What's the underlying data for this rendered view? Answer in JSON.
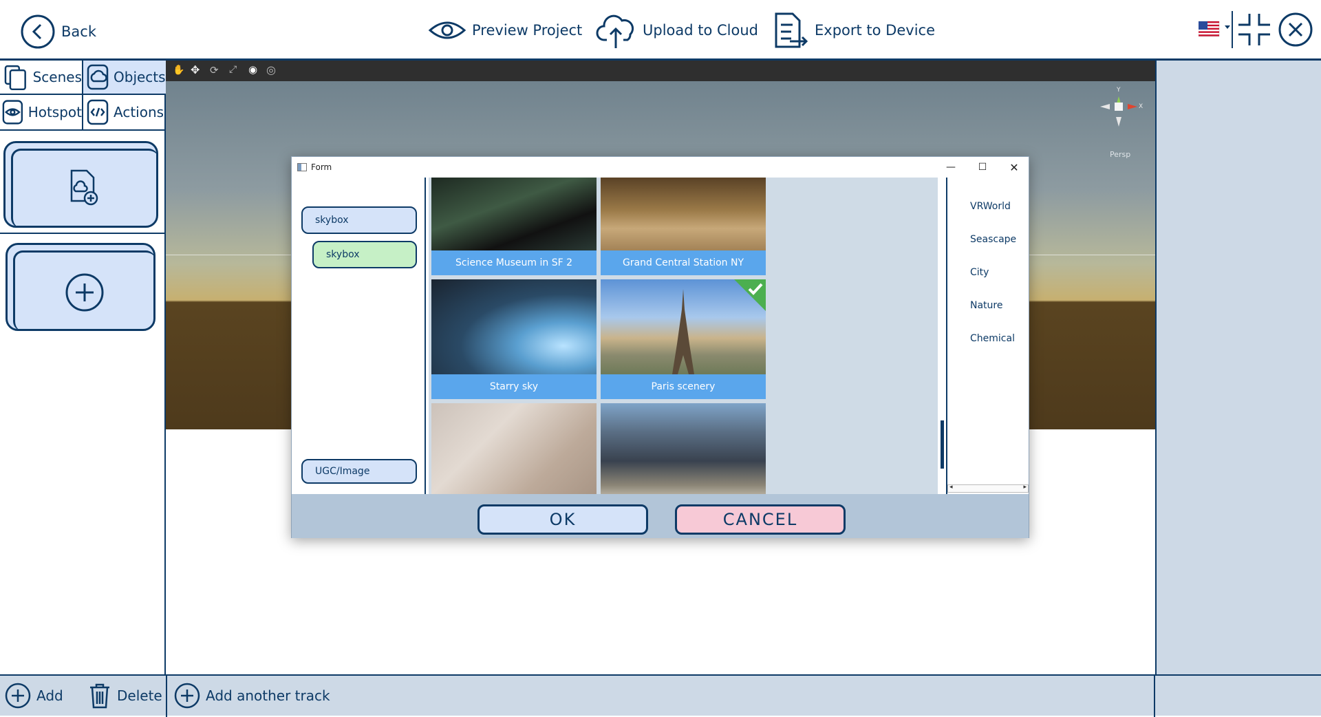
{
  "topbar": {
    "back_label": "Back",
    "preview_label": "Preview Project",
    "upload_label": "Upload to Cloud",
    "export_label": "Export to Device"
  },
  "left": {
    "tabs": {
      "scenes": "Scenes",
      "objects": "Objects",
      "hotspot": "Hotspot",
      "actions": "Actions"
    }
  },
  "bottombar": {
    "add_label": "Add",
    "delete_label": "Delete",
    "add_track_label": "Add another track"
  },
  "viewport": {
    "gizmo_y": "Y",
    "gizmo_x": "X",
    "gizmo_label": "Persp"
  },
  "dialog": {
    "title": "Form",
    "tree": {
      "root": "skybox",
      "child": "skybox",
      "ugc": "UGC/Image"
    },
    "tiles": [
      {
        "caption": "Science Museum in SF 2",
        "selected": false
      },
      {
        "caption": "Grand Central Station NY",
        "selected": false
      },
      {
        "caption": "Starry sky",
        "selected": false
      },
      {
        "caption": "Paris scenery",
        "selected": true
      },
      {
        "caption": "",
        "selected": false
      },
      {
        "caption": "",
        "selected": false
      }
    ],
    "categories": [
      "VRWorld",
      "Seascape",
      "City",
      "Nature",
      "Chemical"
    ],
    "ok_label": "OK",
    "cancel_label": "CANCEL"
  },
  "colors": {
    "primary": "#0d3a66",
    "caption_bg": "#5aa6ec",
    "ok_bg": "#d5e3f9",
    "cancel_bg": "#f7c9d6",
    "tree_child_bg": "#c6f0c6",
    "check_green": "#4caf50"
  }
}
